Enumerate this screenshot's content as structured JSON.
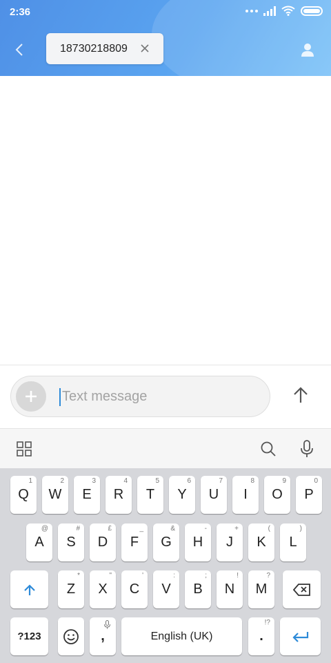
{
  "status": {
    "time": "2:36"
  },
  "header": {
    "recipient": "18730218809"
  },
  "compose": {
    "placeholder": "Text message"
  },
  "keyboard": {
    "row1": [
      {
        "label": "Q",
        "hint": "1"
      },
      {
        "label": "W",
        "hint": "2"
      },
      {
        "label": "E",
        "hint": "3"
      },
      {
        "label": "R",
        "hint": "4"
      },
      {
        "label": "T",
        "hint": "5"
      },
      {
        "label": "Y",
        "hint": "6"
      },
      {
        "label": "U",
        "hint": "7"
      },
      {
        "label": "I",
        "hint": "8"
      },
      {
        "label": "O",
        "hint": "9"
      },
      {
        "label": "P",
        "hint": "0"
      }
    ],
    "row2": [
      {
        "label": "A",
        "hint": "@"
      },
      {
        "label": "S",
        "hint": "#"
      },
      {
        "label": "D",
        "hint": "£"
      },
      {
        "label": "F",
        "hint": "_"
      },
      {
        "label": "G",
        "hint": "&"
      },
      {
        "label": "H",
        "hint": "-"
      },
      {
        "label": "J",
        "hint": "+"
      },
      {
        "label": "K",
        "hint": "("
      },
      {
        "label": "L",
        "hint": ")"
      }
    ],
    "row3": [
      {
        "label": "Z",
        "hint": "*"
      },
      {
        "label": "X",
        "hint": "\""
      },
      {
        "label": "C",
        "hint": "'"
      },
      {
        "label": "V",
        "hint": ":"
      },
      {
        "label": "B",
        "hint": ";"
      },
      {
        "label": "N",
        "hint": "!"
      },
      {
        "label": "M",
        "hint": "?"
      }
    ],
    "symbols_label": "?123",
    "comma": ",",
    "space_label": "English (UK)",
    "period": ".",
    "period_hint": "!?"
  },
  "colors": {
    "header_start": "#4f90e6",
    "accent": "#2d8ad8"
  }
}
